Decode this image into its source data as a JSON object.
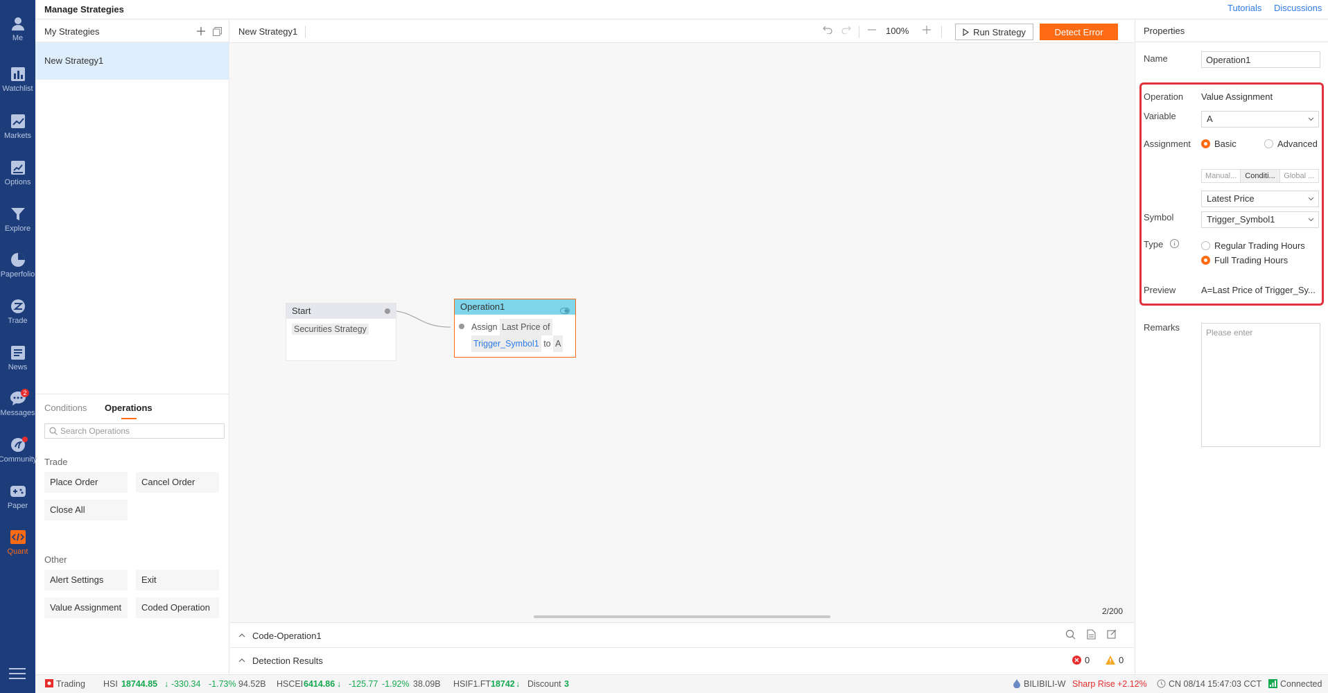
{
  "header": {
    "title": "Manage Strategies",
    "tutorials": "Tutorials",
    "discussions": "Discussions"
  },
  "nav": {
    "items": [
      {
        "label": "Me",
        "icon": "person-icon"
      },
      {
        "label": "Watchlist",
        "icon": "bar-chart-icon"
      },
      {
        "label": "Markets",
        "icon": "trend-icon"
      },
      {
        "label": "Options",
        "icon": "options-icon"
      },
      {
        "label": "Explore",
        "icon": "filter-icon"
      },
      {
        "label": "Paperfolio",
        "icon": "pie-icon"
      },
      {
        "label": "Trade",
        "icon": "trade-icon"
      },
      {
        "label": "News",
        "icon": "news-icon"
      },
      {
        "label": "Messages",
        "icon": "chat-icon",
        "badge": "2"
      },
      {
        "label": "Community",
        "icon": "community-icon"
      },
      {
        "label": "Paper",
        "icon": "gamepad-icon"
      },
      {
        "label": "Quant",
        "icon": "code-icon"
      }
    ],
    "accent": "#ff6a13"
  },
  "strategies": {
    "header": "My Strategies",
    "items": [
      "New Strategy1"
    ]
  },
  "ops": {
    "tabs": [
      "Conditions",
      "Operations"
    ],
    "search_placeholder": "Search Operations",
    "groups": [
      {
        "label": "Trade",
        "items": [
          "Place Order",
          "Cancel Order",
          "Close All"
        ]
      },
      {
        "label": "Other",
        "items": [
          "Alert Settings",
          "Exit",
          "Value Assignment",
          "Coded Operation"
        ]
      }
    ]
  },
  "toolbar": {
    "tab_name": "New Strategy1",
    "zoom": "100%",
    "run": "Run Strategy",
    "detect": "Detect Error"
  },
  "canvas": {
    "start_node": {
      "title": "Start",
      "tag": "Securities Strategy"
    },
    "op_node": {
      "title": "Operation1",
      "assign": "Assign",
      "last_price": "Last Price of",
      "symbol": "Trigger_Symbol1",
      "to": "to",
      "var": "A"
    },
    "count": "2/200"
  },
  "bottom": {
    "code_title": "Code-Operation1",
    "detect_title": "Detection Results",
    "errors": "0",
    "warnings": "0"
  },
  "props": {
    "header": "Properties",
    "name_label": "Name",
    "name_value": "Operation1",
    "operation_label": "Operation",
    "operation_value": "Value Assignment",
    "variable_label": "Variable",
    "variable_value": "A",
    "assignment_label": "Assignment",
    "basic": "Basic",
    "advanced": "Advanced",
    "segments": [
      "Manual...",
      "Conditi...",
      "Global ..."
    ],
    "price_select": "Latest Price",
    "symbol_label": "Symbol",
    "symbol_value": "Trigger_Symbol1",
    "type_label": "Type",
    "type_regular": "Regular Trading Hours",
    "type_full": "Full Trading Hours",
    "preview_label": "Preview",
    "preview_value": "A=Last Price of Trigger_Sy...",
    "remarks_label": "Remarks",
    "remarks_placeholder": "Please enter"
  },
  "status": {
    "trading": "Trading",
    "hsi_label": "HSI",
    "hsi_value": "18744.85",
    "hsi_change": "-330.34",
    "hsi_pct": "-1.73%",
    "hsi_turnover": "94.52B",
    "hscei_label": "HSCEI",
    "hscei_value": "6414.86",
    "hscei_change": "-125.77",
    "hscei_pct": "-1.92%",
    "hscei_turnover": "38.09B",
    "hsif_label": "HSIF1.FT",
    "hsif_value": "18742",
    "discount_label": "Discount",
    "discount_value": "3",
    "alert_symbol": "BILIBILI-W",
    "alert_text": "Sharp Rise",
    "alert_pct": "+2.12%",
    "time": "CN 08/14 15:47:03 CCT",
    "connection": "Connected"
  }
}
